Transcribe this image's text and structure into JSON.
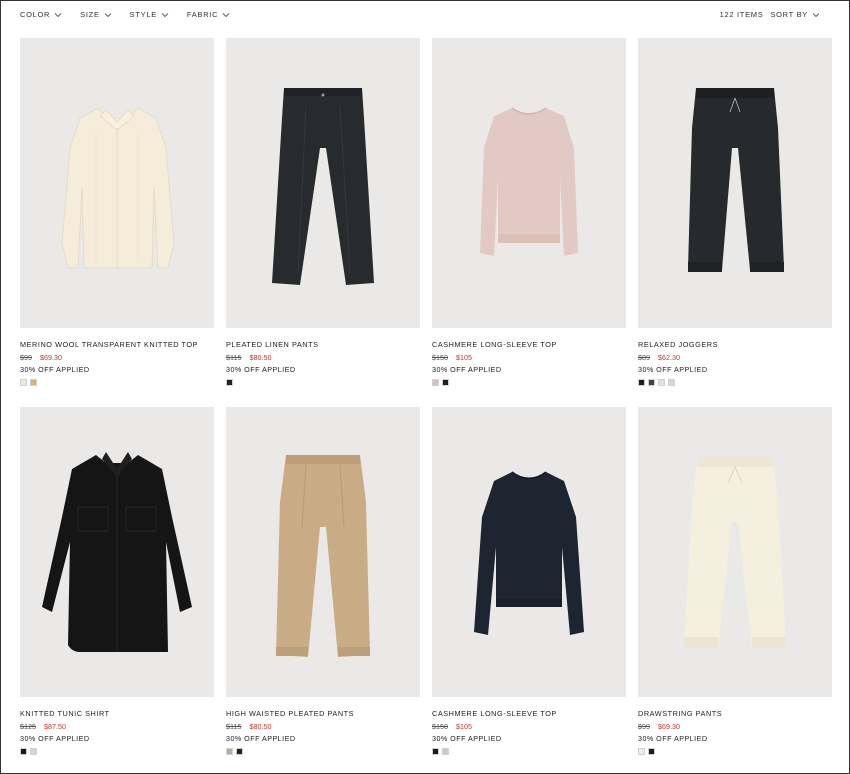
{
  "filters": [
    {
      "label": "COLOR"
    },
    {
      "label": "SIZE"
    },
    {
      "label": "STYLE"
    },
    {
      "label": "FABRIC"
    }
  ],
  "toolbar": {
    "items_count": "122 ITEMS",
    "sort_label": "SORT BY"
  },
  "products": [
    {
      "name": "MERINO WOOL TRANSPARENT KNITTED TOP",
      "old_price": "$99",
      "new_price": "$69.30",
      "promo": "30% OFF APPLIED",
      "swatches": [
        "#f2e8d4",
        "#d9b36a"
      ]
    },
    {
      "name": "PLEATED LINEN PANTS",
      "old_price": "$115",
      "new_price": "$80.50",
      "promo": "30% OFF APPLIED",
      "swatches": [
        "#222222"
      ]
    },
    {
      "name": "CASHMERE LONG-SLEEVE TOP",
      "old_price": "$150",
      "new_price": "$105",
      "promo": "30% OFF APPLIED",
      "swatches": [
        "#d9c0b8",
        "#1f1f1f"
      ]
    },
    {
      "name": "RELAXED JOGGERS",
      "old_price": "$89",
      "new_price": "$62.30",
      "promo": "30% OFF APPLIED",
      "swatches": [
        "#1e1e1e",
        "#3a4352",
        "#e4e1da",
        "#d8d6cc"
      ]
    },
    {
      "name": "KNITTED TUNIC SHIRT",
      "old_price": "$125",
      "new_price": "$87.50",
      "promo": "30% OFF APPLIED",
      "swatches": [
        "#1a1a1a",
        "#d9d6c8"
      ]
    },
    {
      "name": "HIGH WAISTED PLEATED PANTS",
      "old_price": "$115",
      "new_price": "$80.50",
      "promo": "30% OFF APPLIED",
      "swatches": [
        "#c7a982",
        "#222222"
      ]
    },
    {
      "name": "CASHMERE LONG-SLEEVE TOP",
      "old_price": "$150",
      "new_price": "$105",
      "promo": "30% OFF APPLIED",
      "swatches": [
        "#1b1b1b",
        "#dbc4bc"
      ]
    },
    {
      "name": "DRAWSTRING PANTS",
      "old_price": "$99",
      "new_price": "$69.30",
      "promo": "30% OFF APPLIED",
      "swatches": [
        "#f1ecd9",
        "#1c1c1c"
      ]
    }
  ],
  "colors": {
    "sale_price": "#c0392b",
    "image_background": "#eae9e7"
  }
}
